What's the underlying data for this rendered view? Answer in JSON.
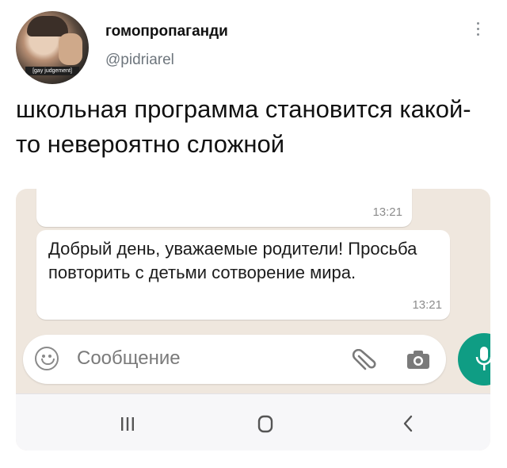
{
  "post": {
    "author_name": "гомопропаганди",
    "author_handle": "@pidriarel",
    "avatar_tag": "[gay judgement]",
    "text": "школьная программа становится какой-то невероятно сложной"
  },
  "chat": {
    "message1_time": "13:21",
    "message2_text": "Добрый день, уважаемые родители! Просьба повторить с детьми сотворение мира.",
    "message2_time": "13:21",
    "composer_placeholder": "Сообщение"
  },
  "icons": {
    "more": "more-vertical-icon",
    "emoji": "emoji-icon",
    "attach": "paperclip-icon",
    "camera": "camera-icon",
    "mic": "microphone-icon",
    "nav_recent": "recent-apps-icon",
    "nav_home": "home-icon",
    "nav_back": "back-icon"
  },
  "colors": {
    "chat_background": "#efe7de",
    "mic_button": "#0f9d84",
    "handle_gray": "#6e767d"
  }
}
